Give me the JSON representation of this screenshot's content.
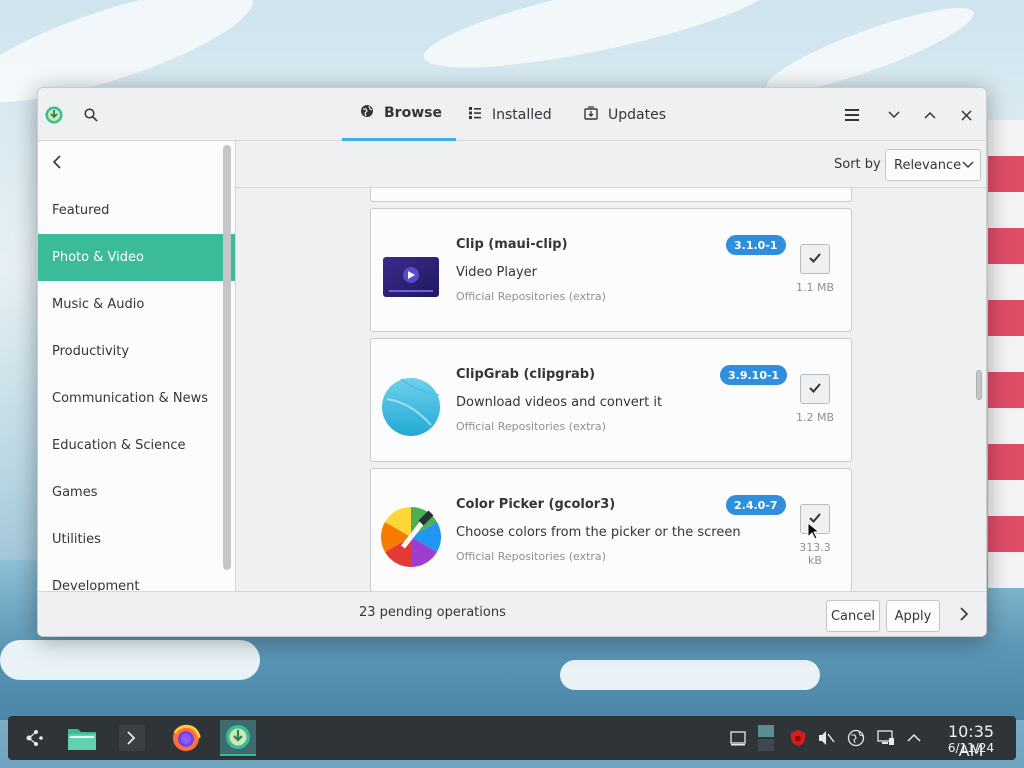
{
  "window": {
    "tabs": [
      {
        "label": "Browse",
        "icon": "globe-icon",
        "active": true
      },
      {
        "label": "Installed",
        "icon": "list-icon",
        "active": false
      },
      {
        "label": "Updates",
        "icon": "updates-icon",
        "active": false
      }
    ]
  },
  "sidebar": {
    "items": [
      {
        "label": "Featured"
      },
      {
        "label": "Photo & Video",
        "active": true
      },
      {
        "label": "Music & Audio"
      },
      {
        "label": "Productivity"
      },
      {
        "label": "Communication & News"
      },
      {
        "label": "Education & Science"
      },
      {
        "label": "Games"
      },
      {
        "label": "Utilities"
      },
      {
        "label": "Development"
      }
    ]
  },
  "sort": {
    "label": "Sort by",
    "value": "Relevance"
  },
  "apps": [
    {
      "name": "Clip (maui-clip)",
      "version": "3.1.0-1",
      "description": "Video Player",
      "repo": "Official Repositories (extra)",
      "size": "1.1 MB",
      "icon": "video-player-icon"
    },
    {
      "name": "ClipGrab (clipgrab)",
      "version": "3.9.10-1",
      "description": "Download videos and convert it",
      "repo": "Official Repositories (extra)",
      "size": "1.2 MB",
      "icon": "clipgrab-icon"
    },
    {
      "name": "Color Picker (gcolor3)",
      "version": "2.4.0-7",
      "description": "Choose colors from the picker or the screen",
      "repo": "Official Repositories (extra)",
      "size": "313.3 kB",
      "icon": "color-picker-icon"
    }
  ],
  "footer": {
    "pending": "23 pending operations",
    "cancel_label": "Cancel",
    "apply_label": "Apply"
  },
  "taskbar": {
    "time": "10:35 AM",
    "date": "6/11/24"
  },
  "colors": {
    "accent": "#3bbb9a",
    "badge": "#2f8fdc",
    "tab_underline": "#3daee9"
  }
}
